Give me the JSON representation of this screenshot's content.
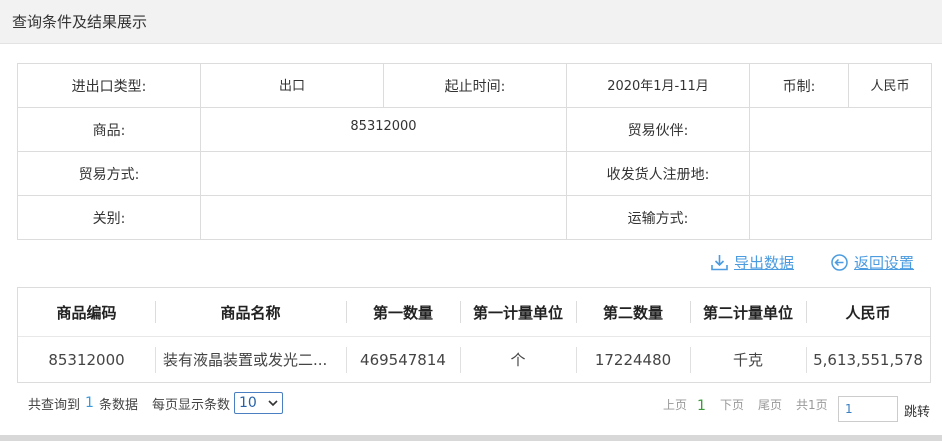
{
  "header": {
    "title": "查询条件及结果展示"
  },
  "criteria": {
    "row1": {
      "trade_type_label": "进出口类型:",
      "trade_type_value": "出口",
      "period_label": "起止时间:",
      "period_value": "2020年1月-11月",
      "currency_label": "币制:",
      "currency_value": "人民币"
    },
    "row2": {
      "goods_label": "商品:",
      "goods_value": "85312000",
      "partner_label": "贸易伙伴:",
      "partner_value": ""
    },
    "row3": {
      "mode_label": "贸易方式:",
      "mode_value": "",
      "consignee_label": "收发货人注册地:",
      "consignee_value": ""
    },
    "row4": {
      "customs_label": "关别:",
      "customs_value": "",
      "transport_label": "运输方式:",
      "transport_value": ""
    }
  },
  "actions": {
    "export": "导出数据",
    "reset": "返回设置"
  },
  "results": {
    "columns": [
      "商品编码",
      "商品名称",
      "第一数量",
      "第一计量单位",
      "第二数量",
      "第二计量单位",
      "人民币"
    ],
    "rows": [
      [
        "85312000",
        "装有液晶装置或发光二...",
        "469547814",
        "个",
        "17224480",
        "千克",
        "5,613,551,578"
      ]
    ]
  },
  "footer": {
    "total_prefix": "共查询到",
    "total_count": "1",
    "total_suffix": "条数据",
    "page_size_label": "每页显示条数",
    "page_size_value": "10",
    "prev": "上页",
    "current_page": "1",
    "next": "下页",
    "last": "尾页",
    "page_count": "共1页",
    "page_input": "1",
    "jump": "跳转"
  }
}
